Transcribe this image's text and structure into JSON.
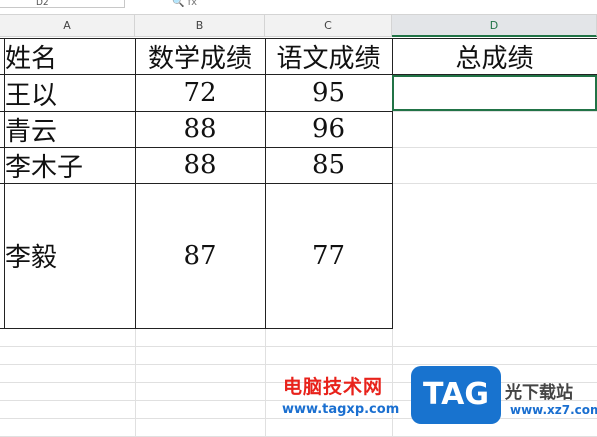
{
  "namebox": {
    "value": "D2"
  },
  "formula_bar": {
    "fx_label": "fx"
  },
  "columns": [
    {
      "label": "A",
      "selected": false
    },
    {
      "label": "B",
      "selected": false
    },
    {
      "label": "C",
      "selected": false
    },
    {
      "label": "D",
      "selected": true
    }
  ],
  "header_row": [
    "姓名",
    "数学成绩",
    "语文成绩",
    "总成绩"
  ],
  "rows": [
    {
      "name": "王以",
      "math": "72",
      "chinese": "95",
      "total": ""
    },
    {
      "name": "青云",
      "math": "88",
      "chinese": "96",
      "total": ""
    },
    {
      "name": "李木子",
      "math": "88",
      "chinese": "85",
      "total": ""
    },
    {
      "name": "李毅",
      "math": "87",
      "chinese": "77",
      "total": ""
    }
  ],
  "watermark": {
    "site_cn": "电脑技术网",
    "site_url": "www.tagxp.com",
    "logo_text": "TAG",
    "right_cn": "光下载站",
    "right_url": "www.xz7.com"
  },
  "colors": {
    "accent": "#217346",
    "watermark_red": "#e8221b",
    "watermark_blue": "#1873cf"
  }
}
